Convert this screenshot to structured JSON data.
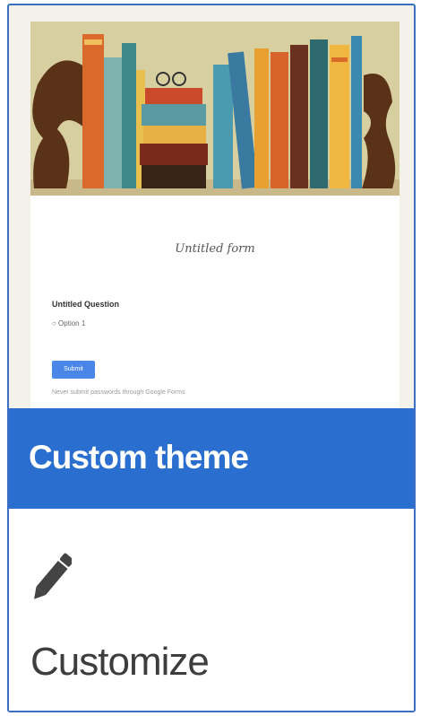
{
  "preview": {
    "form_title": "Untitled form",
    "question_title": "Untitled Question",
    "option_label": "○ Option 1",
    "submit_label": "Submit",
    "footer_note": "Never submit passwords through Google Forms"
  },
  "theme": {
    "title": "Custom theme"
  },
  "customize": {
    "icon": "pencil-icon",
    "label": "Customize"
  },
  "colors": {
    "accent": "#2a6fd0",
    "card_border": "#3a6fc4",
    "banner_bg": "#d8cfa0",
    "submit_button": "#4a86e8"
  }
}
